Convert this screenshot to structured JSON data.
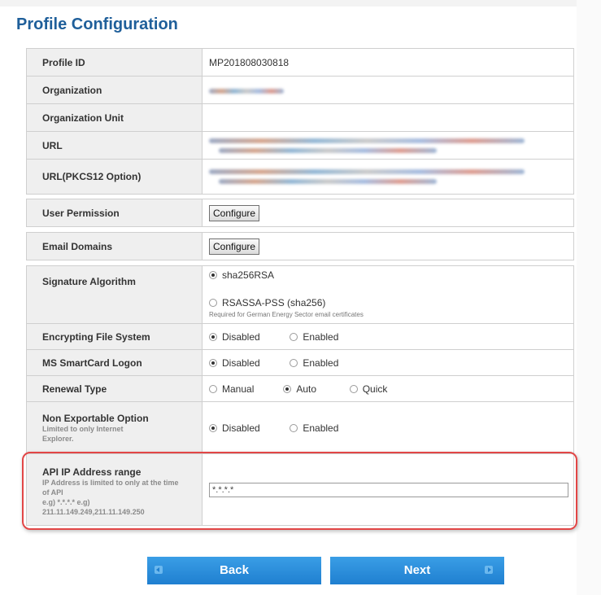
{
  "page": {
    "title": "Profile Configuration"
  },
  "profile": {
    "profile_id_label": "Profile ID",
    "profile_id_value": "MP201808030818",
    "organization_label": "Organization",
    "organization_unit_label": "Organization Unit",
    "url_label": "URL",
    "url_pkcs12_label": "URL(PKCS12 Option)"
  },
  "permissions": {
    "user_permission_label": "User Permission",
    "user_permission_button": "Configure",
    "email_domains_label": "Email Domains",
    "email_domains_button": "Configure"
  },
  "settings": {
    "signature_algorithm_label": "Signature Algorithm",
    "sig_option_1": "sha256RSA",
    "sig_option_2": "RSASSA-PSS (sha256)",
    "sig_option_2_hint": "Required for German Energy Sector email certificates",
    "sig_selected": "sha256RSA",
    "efs_label": "Encrypting File System",
    "efs_disabled": "Disabled",
    "efs_enabled": "Enabled",
    "efs_selected": "Disabled",
    "ms_smartcard_label": "MS SmartCard Logon",
    "ms_disabled": "Disabled",
    "ms_enabled": "Enabled",
    "ms_selected": "Disabled",
    "renewal_label": "Renewal Type",
    "renewal_manual": "Manual",
    "renewal_auto": "Auto",
    "renewal_quick": "Quick",
    "renewal_selected": "Auto",
    "nonexport_label": "Non Exportable Option",
    "nonexport_sub": "Limited to only Internet Explorer.",
    "nonexport_disabled": "Disabled",
    "nonexport_enabled": "Enabled",
    "nonexport_selected": "Disabled",
    "api_ip_label": "API IP Address range",
    "api_ip_sub_1": "IP Address is limited to only at the time of API",
    "api_ip_sub_2": "e.g) *.*.*.* e.g)",
    "api_ip_sub_3": "211.11.149.249,211.11.149.250",
    "api_ip_value": "*.*.*.*"
  },
  "footer": {
    "back_label": "Back",
    "next_label": "Next"
  },
  "colors": {
    "accent": "#1f5f9a",
    "button_blue": "#2a8fdc",
    "highlight_red": "#e24646"
  }
}
